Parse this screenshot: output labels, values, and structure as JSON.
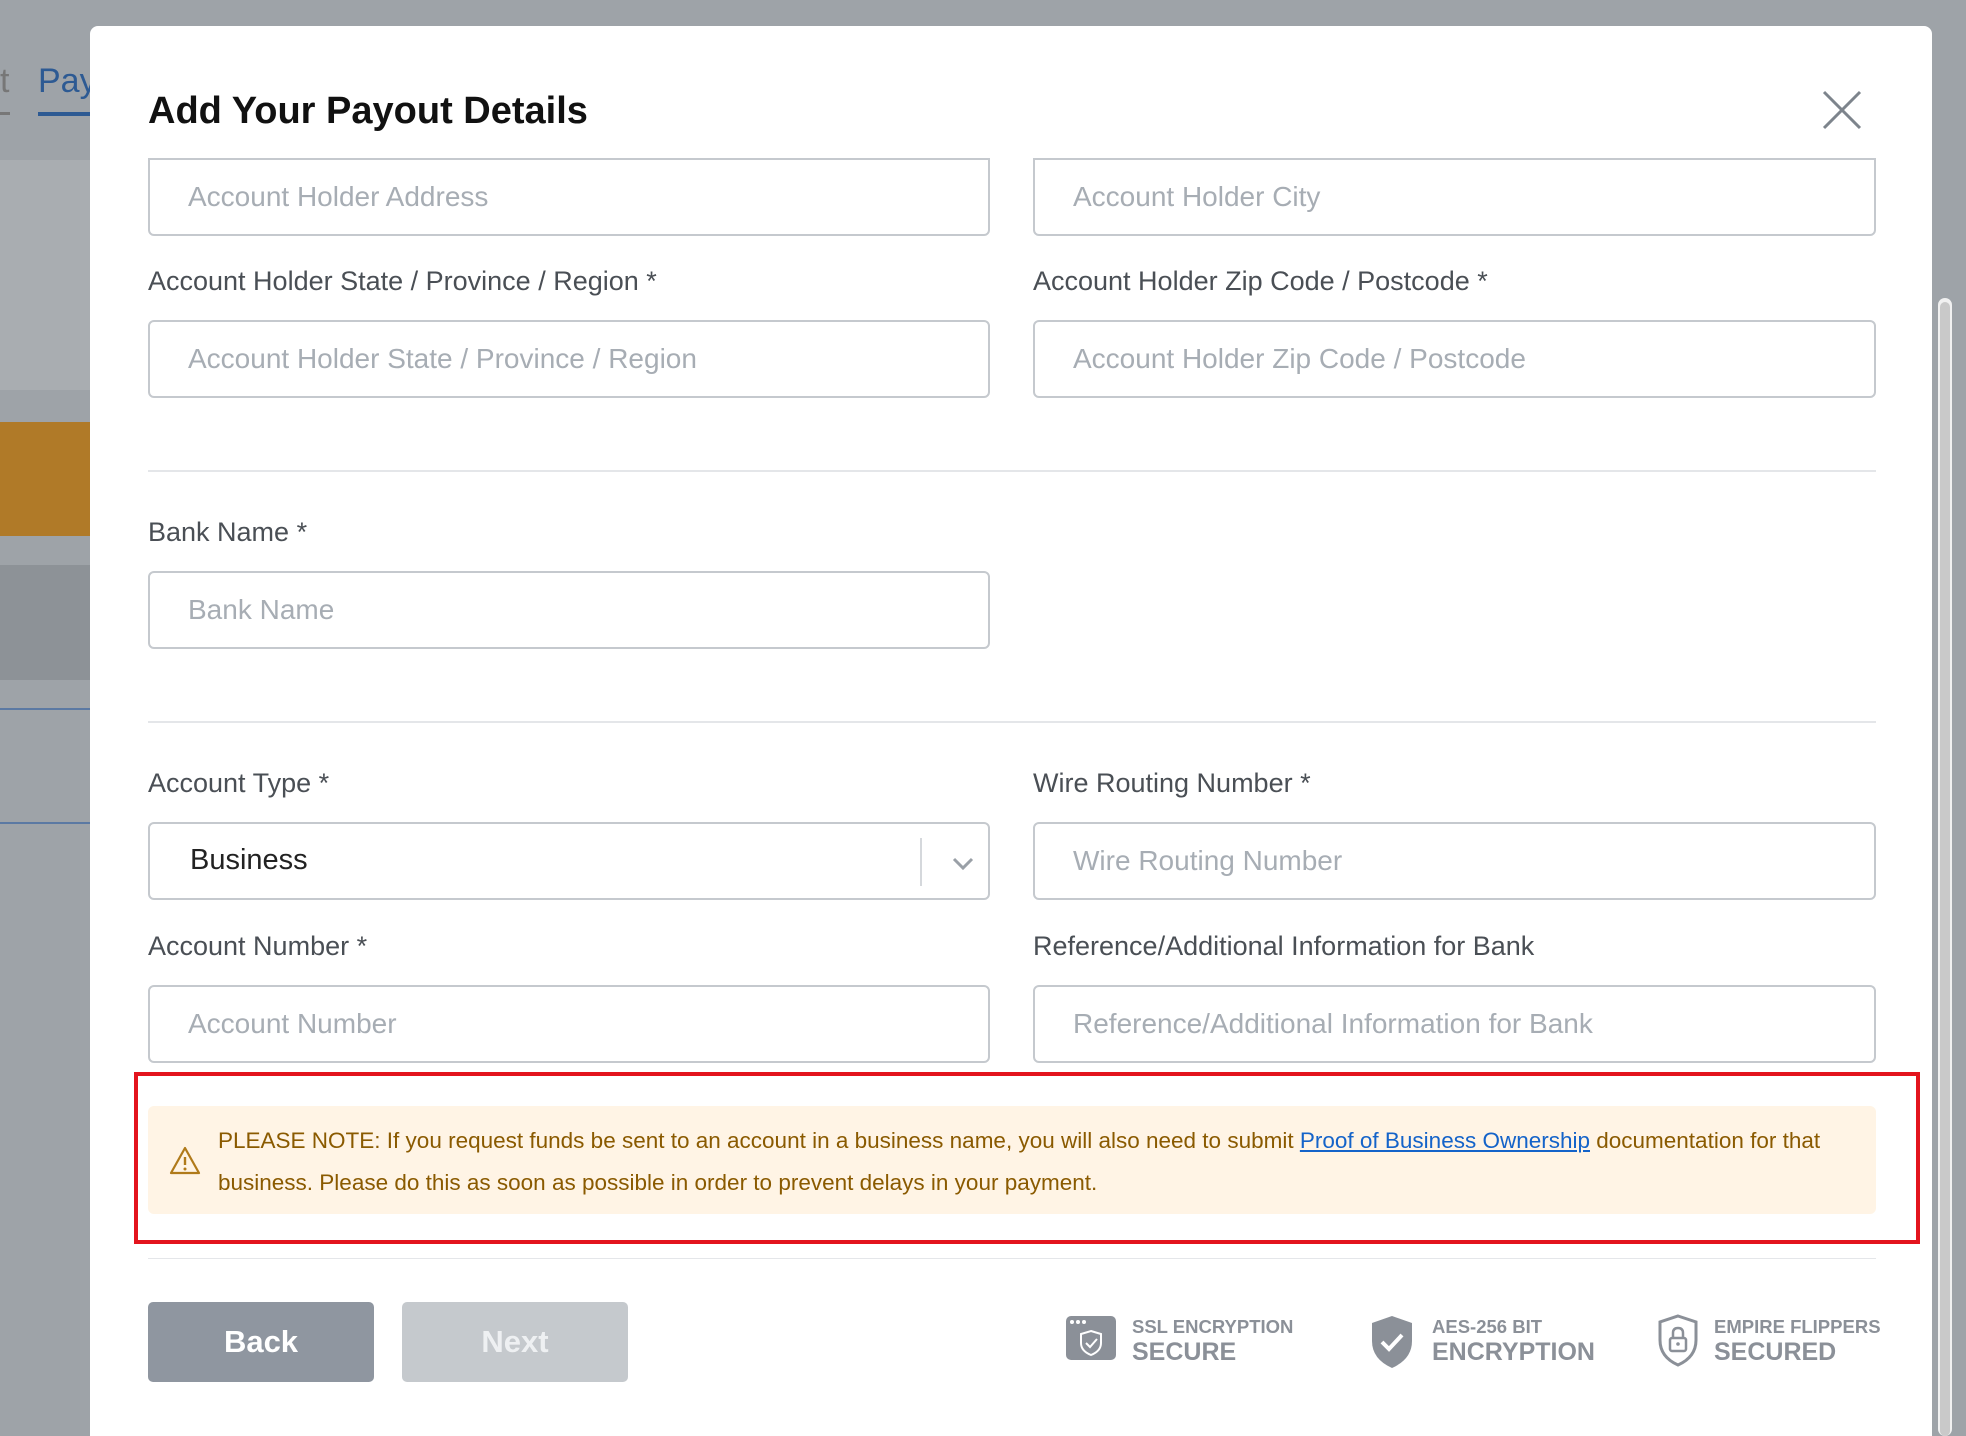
{
  "background": {
    "tab_partial": "t",
    "tab_payout_partial": "Pay"
  },
  "modal": {
    "title": "Add Your Payout Details",
    "close_icon": "close-icon"
  },
  "fields": {
    "address_placeholder": "Account Holder Address",
    "city_placeholder": "Account Holder City",
    "state_label": "Account Holder State / Province / Region *",
    "state_placeholder": "Account Holder State / Province / Region",
    "zip_label": "Account Holder Zip Code / Postcode *",
    "zip_placeholder": "Account Holder Zip Code / Postcode",
    "bank_name_label": "Bank Name *",
    "bank_name_placeholder": "Bank Name",
    "account_type_label": "Account Type *",
    "account_type_value": "Business",
    "wire_routing_label": "Wire Routing Number *",
    "wire_routing_placeholder": "Wire Routing Number",
    "account_number_label": "Account Number *",
    "account_number_placeholder": "Account Number",
    "reference_label": "Reference/Additional Information for Bank",
    "reference_placeholder": "Reference/Additional Information for Bank"
  },
  "note": {
    "icon": "warning-icon",
    "text_before": "PLEASE NOTE: If you request funds be sent to an account in a business name, you will also need to submit ",
    "link_text": "Proof of Business Ownership",
    "text_after": " documentation for that business. Please do this as soon as possible in order to prevent delays in your payment."
  },
  "buttons": {
    "back": "Back",
    "next": "Next"
  },
  "badges": [
    {
      "icon": "ssl-browser-shield-icon",
      "line1": "SSL ENCRYPTION",
      "line2": "SECURE"
    },
    {
      "icon": "shield-check-icon",
      "line1": "AES-256 BIT",
      "line2": "ENCRYPTION"
    },
    {
      "icon": "lock-shield-icon",
      "line1": "EMPIRE FLIPPERS",
      "line2": "SECURED"
    }
  ],
  "colors": {
    "highlight_border": "#e3141d",
    "note_background": "#fff4e5",
    "note_text": "#8a5a00",
    "link": "#1463c9",
    "back_button": "#8f96a0",
    "next_button_disabled": "#c5c9cd"
  }
}
